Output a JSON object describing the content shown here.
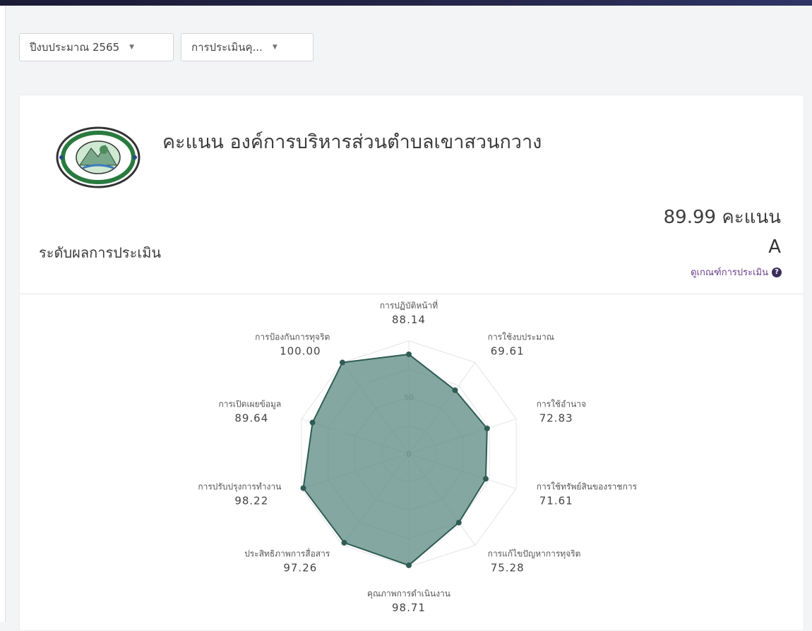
{
  "filters": {
    "year_label": "ปีงบประมาณ 2565",
    "assessment_label": "การประเมินคุ..."
  },
  "header": {
    "title": "คะแนน องค์การบริหารส่วนตำบลเขาสวนกวาง",
    "score_text": "89.99 คะแนน",
    "level_label": "ระดับผลการประเมิน",
    "grade": "A",
    "criteria_link": "ดูเกณฑ์การประเมิน"
  },
  "icons": {
    "help": "question-circle-icon",
    "caret": "chevron-down-icon",
    "logo": "organization-seal-logo"
  },
  "colors": {
    "fill": "#5b8a82",
    "stroke": "#2f5c54",
    "link": "#6a3f8c"
  },
  "chart_data": {
    "type": "radar",
    "categories": [
      "การปฏิบัติหน้าที่",
      "การใช้งบประมาณ",
      "การใช้อำนาจ",
      "การใช้ทรัพย์สินของราชการ",
      "การแก้ไขปัญหาการทุจริต",
      "คุณภาพการดำเนินงาน",
      "ประสิทธิภาพการสื่อสาร",
      "การปรับปรุงการทำงาน",
      "การเปิดเผยข้อมูล",
      "การป้องกันการทุจริต"
    ],
    "values": [
      88.14,
      69.61,
      72.83,
      71.61,
      75.28,
      98.71,
      97.26,
      98.22,
      89.64,
      100.0
    ],
    "value_labels": [
      "88.14",
      "69.61",
      "72.83",
      "71.61",
      "75.28",
      "98.71",
      "97.26",
      "98.22",
      "89.64",
      "100.00"
    ],
    "radial_ticks": [
      "0",
      "50"
    ],
    "range": [
      0,
      100
    ],
    "grid": true
  }
}
